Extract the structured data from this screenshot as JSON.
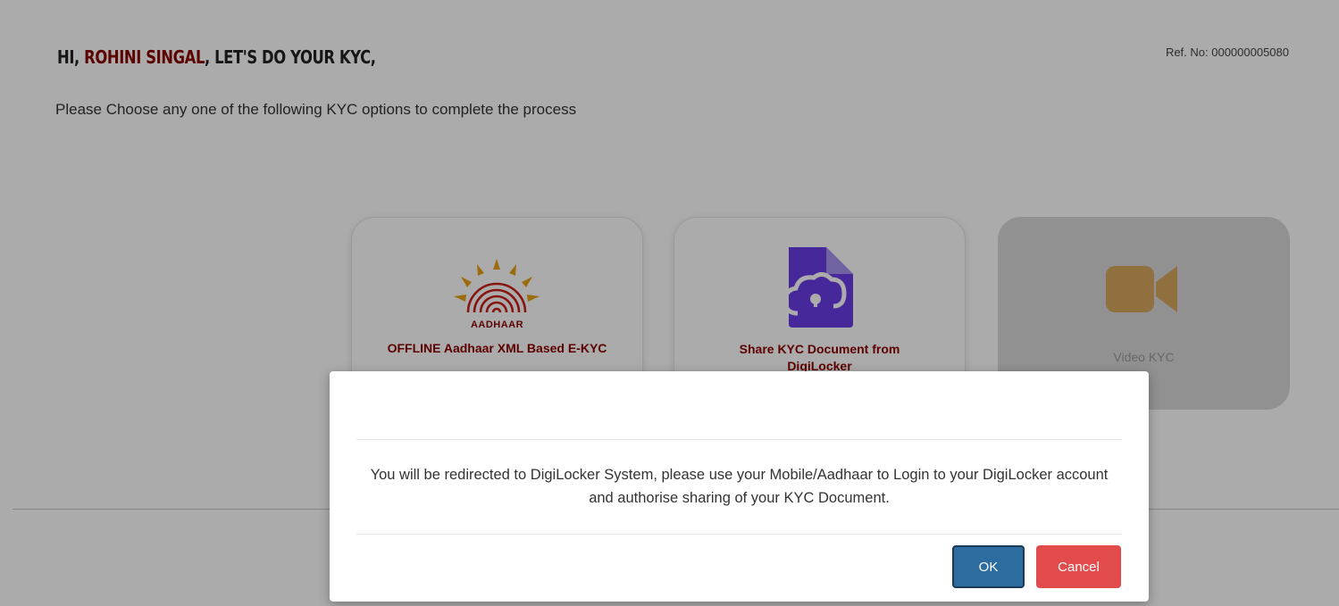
{
  "header": {
    "greeting_prefix": "HI, ",
    "user_name": "ROHINI SINGAL",
    "greeting_suffix": ", LET'S DO YOUR KYC,",
    "ref_label": "Ref. No: 000000005080",
    "instruction": "Please Choose any one of the following KYC options to complete the process"
  },
  "options": [
    {
      "label": "OFFLINE Aadhaar XML Based E-KYC",
      "logo_text": "AADHAAR",
      "icon": "aadhaar-logo-icon"
    },
    {
      "label": "Share KYC Document from DigiLocker",
      "icon": "digilocker-icon"
    },
    {
      "label": "Video KYC",
      "icon": "video-camera-icon"
    }
  ],
  "modal": {
    "message": "You will be redirected to DigiLocker System, please use your Mobile/Aadhaar to Login to your DigiLocker account and authorise sharing of your KYC Document.",
    "ok_label": "OK",
    "cancel_label": "Cancel"
  },
  "colors": {
    "accent_name": "#8b0000",
    "ok_button": "#2d6c9e",
    "cancel_button": "#e14b4b",
    "digilocker_icon": "#6a3de8",
    "video_icon": "#d9a860"
  }
}
